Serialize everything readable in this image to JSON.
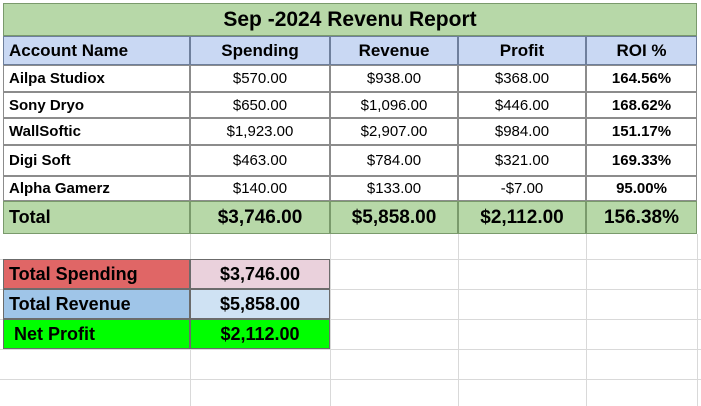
{
  "report": {
    "title": "Sep -2024 Revenu Report",
    "columns": [
      "Account Name",
      "Spending",
      "Revenue",
      "Profit",
      "ROI %"
    ],
    "rows": [
      [
        "Ailpa Studiox",
        "$570.00",
        "$938.00",
        "$368.00",
        "164.56%"
      ],
      [
        "Sony Dryo",
        "$650.00",
        "$1,096.00",
        "$446.00",
        "168.62%"
      ],
      [
        "WallSoftic",
        "$1,923.00",
        "$2,907.00",
        "$984.00",
        "151.17%"
      ],
      [
        "Digi Soft",
        "$463.00",
        "$784.00",
        "$321.00",
        "169.33%"
      ],
      [
        "Alpha Gamerz",
        "$140.00",
        "$133.00",
        "-$7.00",
        "95.00%"
      ]
    ],
    "total": [
      "Total",
      "$3,746.00",
      "$5,858.00",
      "$2,112.00",
      "156.38%"
    ]
  },
  "summary": [
    {
      "label": "Total Spending",
      "value": "$3,746.00",
      "label_color": "#e06666",
      "value_color": "#ead1dc"
    },
    {
      "label": "Total Revenue",
      "value": "$5,858.00",
      "label_color": "#9fc5e8",
      "value_color": "#cfe2f3"
    },
    {
      "label": "Net Profit",
      "value": "$2,112.00",
      "label_color": "#00ff00",
      "value_color": "#00ff00"
    }
  ],
  "colors": {
    "title_bg": "#b7d8a8",
    "header_bg": "#c9d8f3",
    "total_bg": "#b7d8a8"
  }
}
